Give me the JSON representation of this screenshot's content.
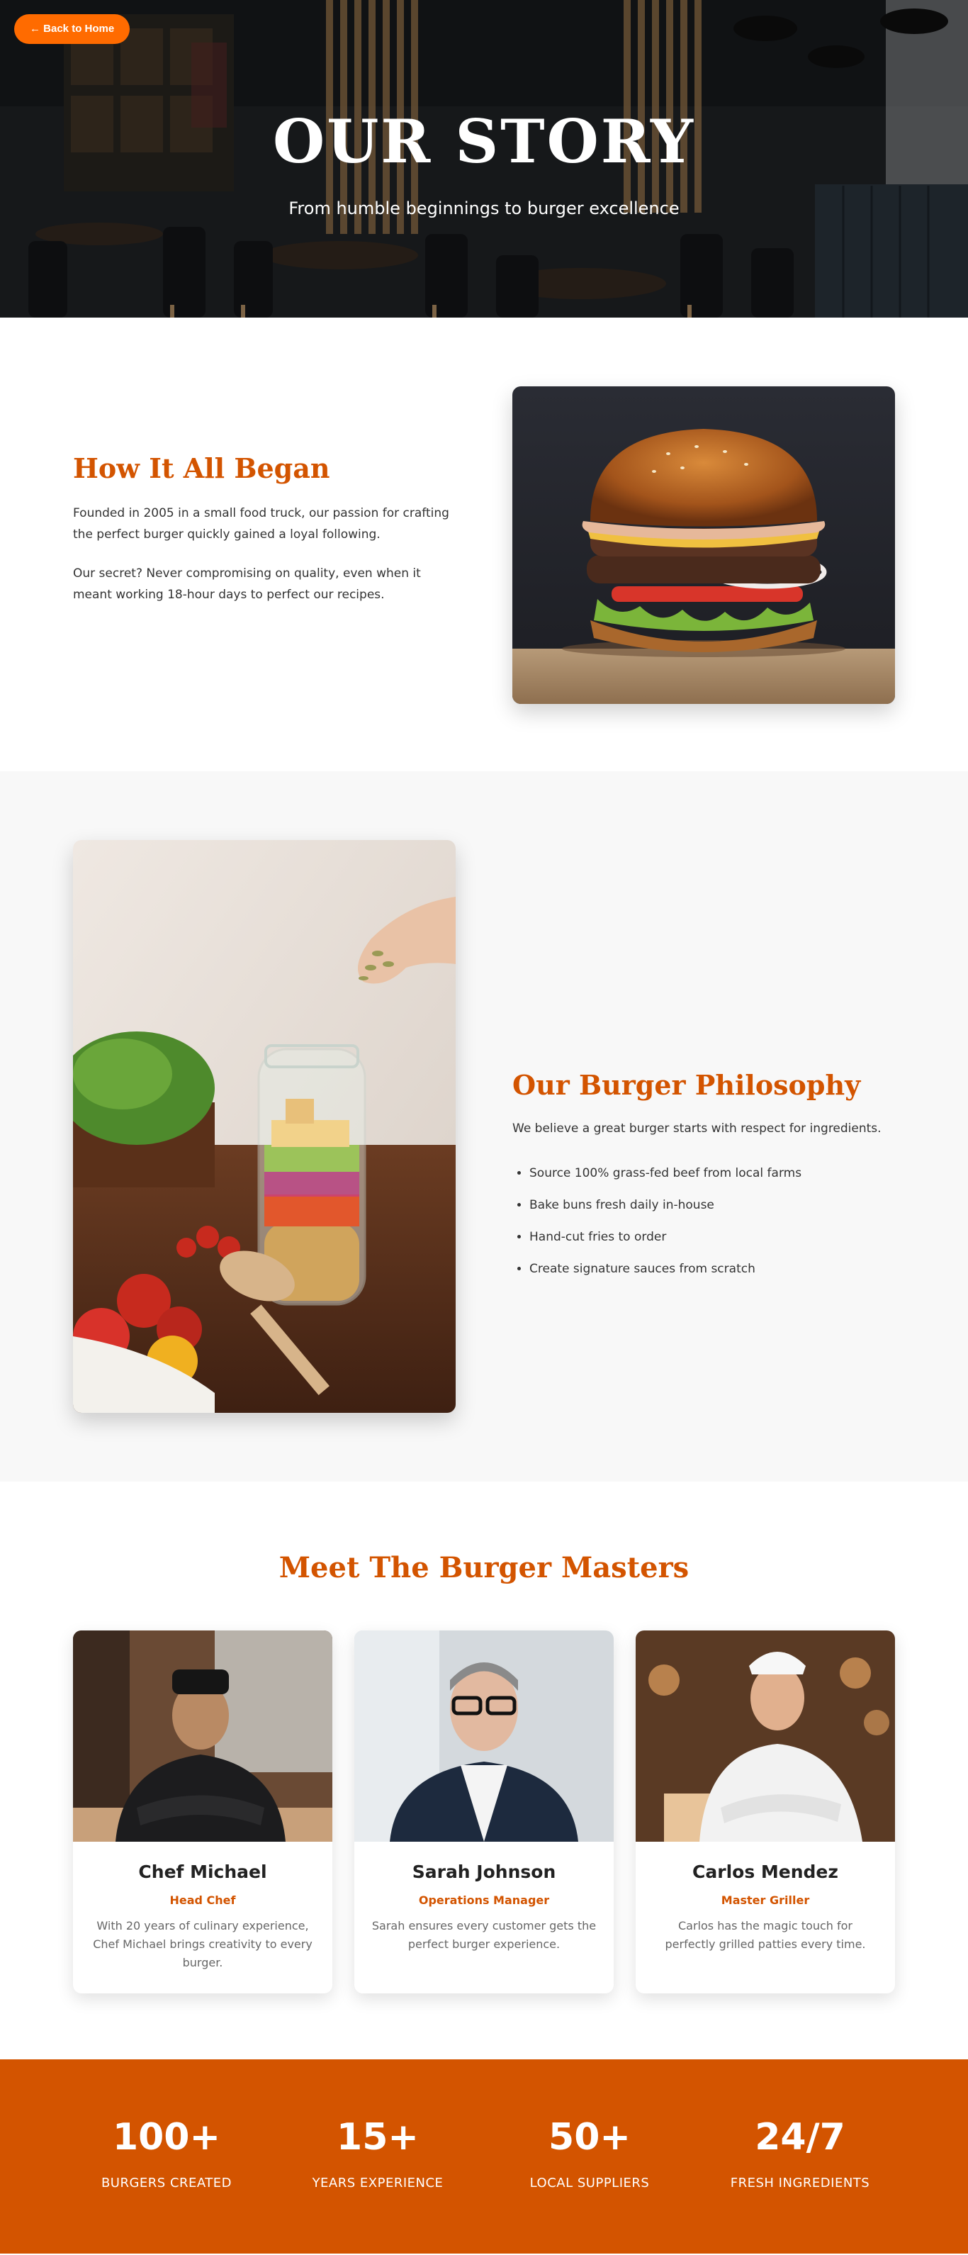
{
  "nav": {
    "back_label": "← Back to Home"
  },
  "hero": {
    "title": "OUR STORY",
    "subtitle": "From humble beginnings to burger excellence"
  },
  "story": {
    "heading": "How It All Began",
    "paragraphs": [
      "Founded in 2005 in a small food truck, our passion for crafting the perfect burger quickly gained a loyal following.",
      "Our secret? Never compromising on quality, even when it meant working 18-hour days to perfect our recipes."
    ]
  },
  "philosophy": {
    "heading": "Our Burger Philosophy",
    "intro": "We believe a great burger starts with respect for ingredients.",
    "items": [
      "Source 100% grass-fed beef from local farms",
      "Bake buns fresh daily in-house",
      "Hand-cut fries to order",
      "Create signature sauces from scratch"
    ]
  },
  "team": {
    "heading": "Meet The Burger Masters",
    "members": [
      {
        "name": "Chef Michael",
        "role": "Head Chef",
        "bio": "With 20 years of culinary experience, Chef Michael brings creativity to every burger."
      },
      {
        "name": "Sarah Johnson",
        "role": "Operations Manager",
        "bio": "Sarah ensures every customer gets the perfect burger experience."
      },
      {
        "name": "Carlos Mendez",
        "role": "Master Griller",
        "bio": "Carlos has the magic touch for perfectly grilled patties every time."
      }
    ]
  },
  "stats": [
    {
      "value": "100+",
      "label": "BURGERS CREATED"
    },
    {
      "value": "15+",
      "label": "YEARS EXPERIENCE"
    },
    {
      "value": "50+",
      "label": "LOCAL SUPPLIERS"
    },
    {
      "value": "24/7",
      "label": "FRESH INGREDIENTS"
    }
  ],
  "colors": {
    "accent": "#d35400",
    "button": "#ff6b00",
    "section_alt_bg": "#f8f8f8"
  }
}
